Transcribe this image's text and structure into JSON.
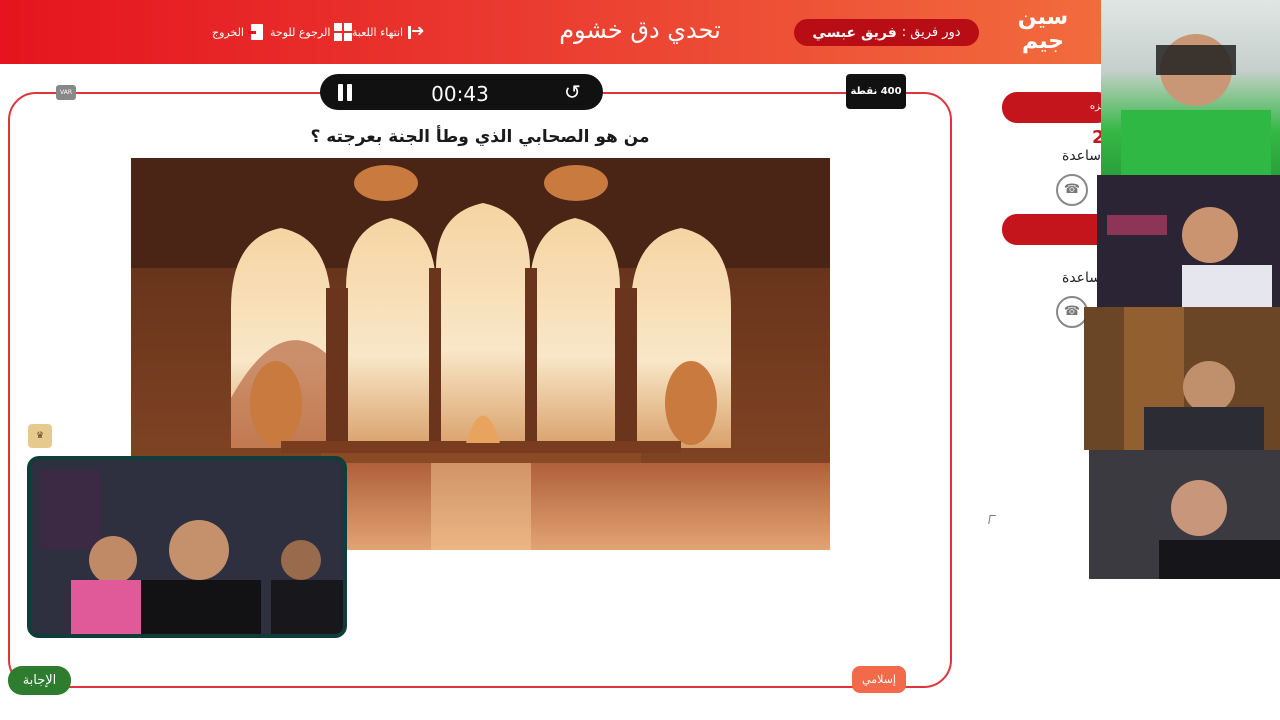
{
  "header": {
    "game_title": "تحدي دق خشوم",
    "turn_label": "دور فريق :",
    "turn_team": "فريق عبسي",
    "nav": {
      "end_game": "انتهاء اللعبة",
      "back_to_board": "الرجوع للوحة",
      "exit": "الخروج"
    },
    "logo_text": "سين جيم"
  },
  "timer": {
    "time": "00:43"
  },
  "var_label": "VAR",
  "points_label": "400 نقطة",
  "question": "من هو الصحابي الذي وطأ الجنة بعرجته ؟",
  "category": "إسلامي",
  "answer_button": "الإجابة",
  "teams_panel": {
    "team1_name_fragment": "مزه",
    "team1_score": "2",
    "help_label_1": "ساعدة",
    "team2_name_fragment": "",
    "help_label_2": "ساعدة"
  },
  "colors": {
    "brand_red": "#e5141e",
    "header_orange": "#f47a3f",
    "pill_red": "#b80d15",
    "answer_green": "#2e7d2e",
    "category_orange": "#f26a4a"
  },
  "icons": [
    "pause-icon",
    "reset-timer-icon",
    "end-game-icon",
    "board-grid-icon",
    "exit-icon",
    "help-phone-icon",
    "crown-icon"
  ]
}
